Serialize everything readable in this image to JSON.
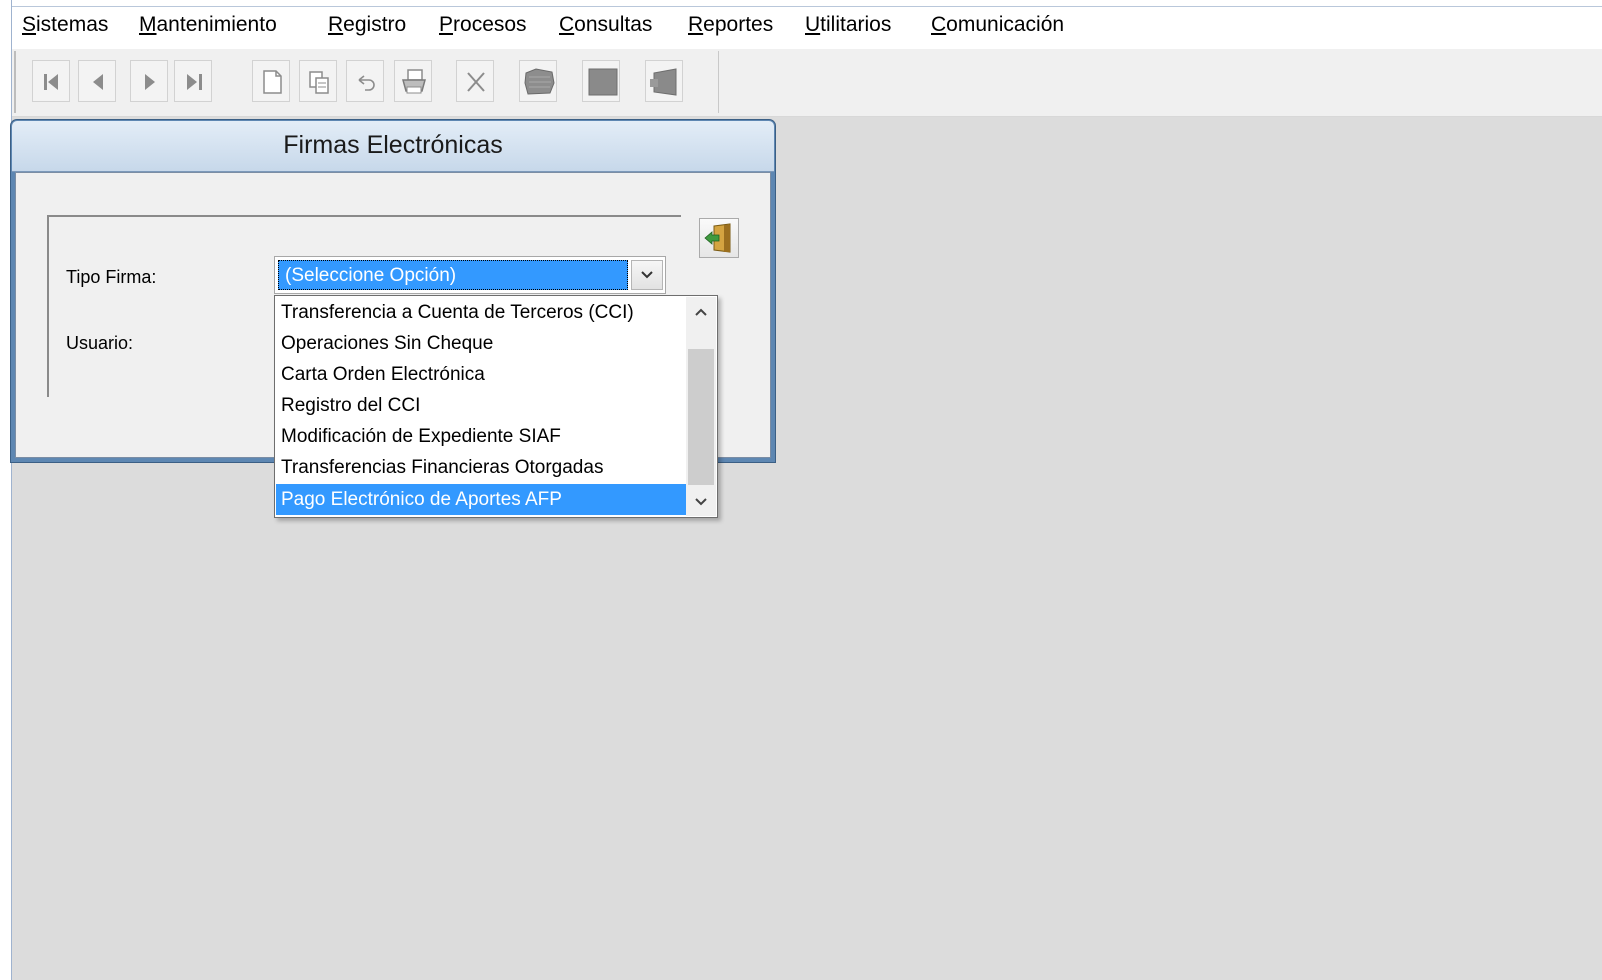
{
  "menubar": {
    "items": [
      {
        "ul": "S",
        "rest": "istemas"
      },
      {
        "ul": "M",
        "rest": "antenimiento"
      },
      {
        "ul": "R",
        "rest": "egistro"
      },
      {
        "ul": "P",
        "rest": "rocesos"
      },
      {
        "ul": "C",
        "rest": "onsultas"
      },
      {
        "ul": "R",
        "rest": "eportes"
      },
      {
        "ul": "U",
        "rest": "tilitarios"
      },
      {
        "ul": "C",
        "rest": "omunicación"
      }
    ]
  },
  "toolbar": {
    "buttons": [
      "first-record-icon",
      "previous-record-icon",
      "next-record-icon",
      "last-record-icon",
      "new-document-icon",
      "copy-icon",
      "undo-icon",
      "print-icon",
      "delete-icon",
      "filter-icon",
      "save-icon",
      "exit-icon"
    ]
  },
  "window": {
    "title": "Firmas Electrónicas",
    "tipo_firma_label": "Tipo Firma:",
    "usuario_label": "Usuario:",
    "combo_value": "(Seleccione Opción)",
    "options": [
      "Transferencia a Cuenta de Terceros (CCI)",
      "Operaciones Sin Cheque",
      "Carta Orden Electrónica",
      "Registro del CCI",
      "Modificación de Expediente SIAF",
      "Transferencias Financieras Otorgadas",
      "Pago Electrónico de Aportes AFP"
    ],
    "selected_option_index": 6
  },
  "colors": {
    "selection": "#3399ff",
    "titlebar": "#c7d8ea",
    "window_border": "#5e87b2"
  }
}
